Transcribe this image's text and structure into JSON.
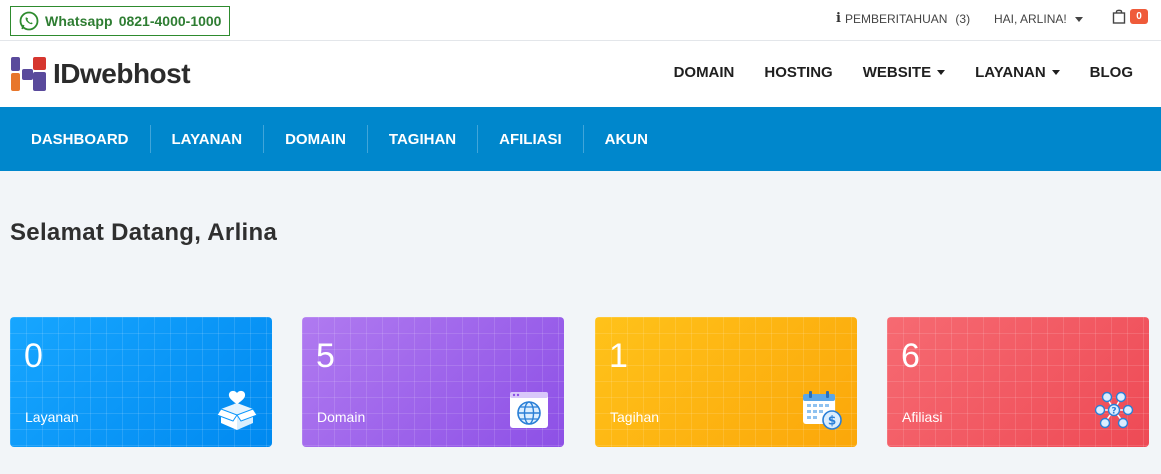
{
  "topbar": {
    "whatsapp_label": "Whatsapp",
    "whatsapp_number": "0821-4000-1000",
    "notifications_label": "PEMBERITAHUAN",
    "notifications_count": "(3)",
    "greeting": "HAI, ARLINA!",
    "cart_count": "0"
  },
  "brand": {
    "name": "IDwebhost"
  },
  "main_nav": [
    {
      "label": "DOMAIN"
    },
    {
      "label": "HOSTING"
    },
    {
      "label": "WEBSITE"
    },
    {
      "label": "LAYANAN"
    },
    {
      "label": "BLOG"
    }
  ],
  "dashboard_nav": [
    {
      "label": "DASHBOARD"
    },
    {
      "label": "LAYANAN"
    },
    {
      "label": "DOMAIN"
    },
    {
      "label": "TAGIHAN"
    },
    {
      "label": "AFILIASI"
    },
    {
      "label": "AKUN"
    }
  ],
  "welcome": "Selamat Datang, Arlina",
  "cards": [
    {
      "value": "0",
      "label": "Layanan",
      "icon": "box-heart-icon",
      "color": "#0a96fb"
    },
    {
      "value": "5",
      "label": "Domain",
      "icon": "globe-browser-icon",
      "color": "#9d64eb"
    },
    {
      "value": "1",
      "label": "Tagihan",
      "icon": "calendar-dollar-icon",
      "color": "#fdb412"
    },
    {
      "value": "6",
      "label": "Afiliasi",
      "icon": "network-people-icon",
      "color": "#f25a63"
    }
  ],
  "colors": {
    "accent_blue": "#0087cc",
    "whatsapp_green": "#2e7d32",
    "cart_badge": "#ef5b3a"
  }
}
